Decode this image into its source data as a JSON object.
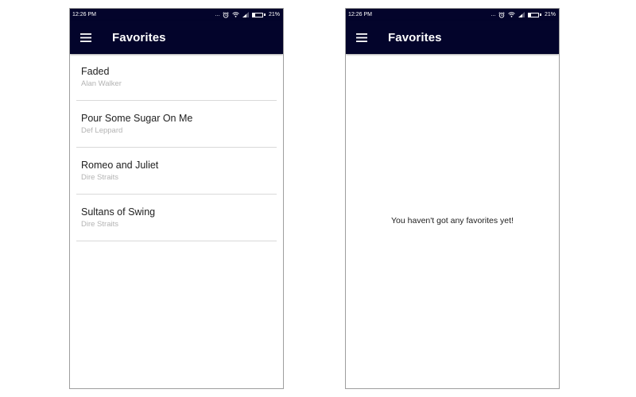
{
  "status_bar": {
    "time": "12:26 PM",
    "dots": "...",
    "battery_percent": "21%",
    "battery_level": 0.21
  },
  "screens": [
    {
      "app_bar": {
        "title": "Favorites",
        "menu_icon": "hamburger-menu-icon"
      },
      "songs": [
        {
          "title": "Faded",
          "artist": "Alan Walker"
        },
        {
          "title": "Pour Some Sugar On Me",
          "artist": "Def Leppard"
        },
        {
          "title": "Romeo and Juliet",
          "artist": "Dire Straits"
        },
        {
          "title": "Sultans of Swing",
          "artist": "Dire Straits"
        }
      ]
    },
    {
      "app_bar": {
        "title": "Favorites",
        "menu_icon": "hamburger-menu-icon"
      },
      "empty_message": "You haven't got any favorites yet!"
    }
  ],
  "colors": {
    "app_bar": "#03042b",
    "title_text": "#212121",
    "subtitle_text": "#b3b3b3",
    "divider": "#d9d9d9"
  }
}
